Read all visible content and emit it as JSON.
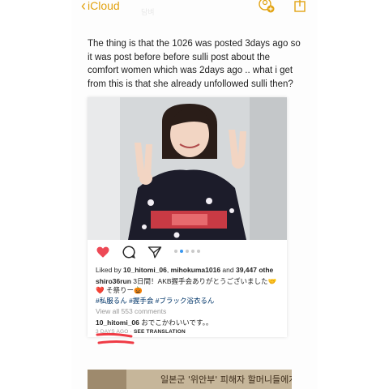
{
  "colors": {
    "accent": "#e2a312",
    "heart": "#ed4956",
    "link": "#003569",
    "muted": "#999999",
    "dot_active": "#3897f0"
  },
  "topbar": {
    "back_label": "iCloud",
    "faded_title": "담벼",
    "icons": [
      "chevron-left-icon",
      "add-person-icon",
      "share-icon"
    ]
  },
  "note": {
    "body": "The thing is that the 1026 was posted 3days ago so it was post before before sulli post about the comfort women which was 2days ago .. what i get from this is that she already unfollowed sulli then?"
  },
  "post": {
    "carousel": {
      "total": 5,
      "active": 1
    },
    "likes_prefix": "Liked by ",
    "likes_user1": "10_hitomi_06",
    "likes_sep": ", ",
    "likes_user2": "mihokuma1016",
    "likes_and": " and ",
    "likes_others": "39,447 othe",
    "caption_user": "shiro36run",
    "caption_text": " 3日間！AKB握手会ありがとうございました🤝❤️ そ祭りー🎃",
    "hashtags": "#私服るん #握手会 #ブラック浴衣るん",
    "view_all": "View all 553 comments",
    "comment_user": "10_hitomi_06",
    "comment_text": " おでこかわいいです。。",
    "time": "3 DAYS AGO",
    "time_sep": " · ",
    "see_translation": "SEE TRANSLATION"
  },
  "book": {
    "text": "일본군 '위안부' 피해자 할머니들에게"
  }
}
